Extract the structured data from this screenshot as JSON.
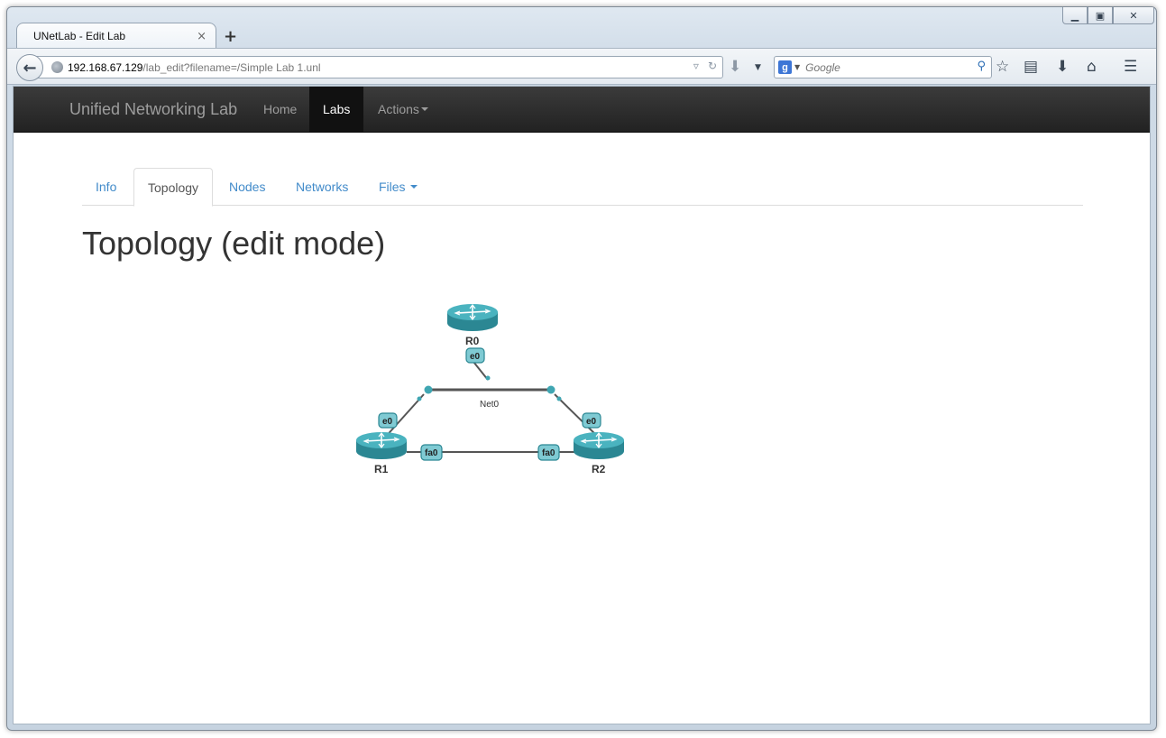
{
  "browser": {
    "tab_title": "UNetLab - Edit Lab",
    "tab_close": "×",
    "new_tab": "+",
    "url_host": "192.168.67.129",
    "url_path": "/lab_edit?filename=/Simple Lab 1.unl",
    "search_placeholder": "Google",
    "search_engine_letter": "g"
  },
  "navbar": {
    "brand": "Unified Networking Lab",
    "items": [
      {
        "label": "Home"
      },
      {
        "label": "Labs"
      },
      {
        "label": "Actions"
      }
    ]
  },
  "page_tabs": [
    {
      "label": "Info"
    },
    {
      "label": "Topology"
    },
    {
      "label": "Nodes"
    },
    {
      "label": "Networks"
    },
    {
      "label": "Files"
    }
  ],
  "page_title": "Topology (edit mode)",
  "topology": {
    "nodes": [
      {
        "name": "R0"
      },
      {
        "name": "R1"
      },
      {
        "name": "R2"
      }
    ],
    "network": {
      "name": "Net0"
    },
    "interfaces": {
      "r0_net0": "e0",
      "r1_net0": "e0",
      "r2_net0": "e0",
      "r1_r2": "fa0",
      "r2_r1": "fa0"
    },
    "colors": {
      "router": "#3fa6b2",
      "router_dark": "#2b8793",
      "link": "#555555"
    }
  }
}
